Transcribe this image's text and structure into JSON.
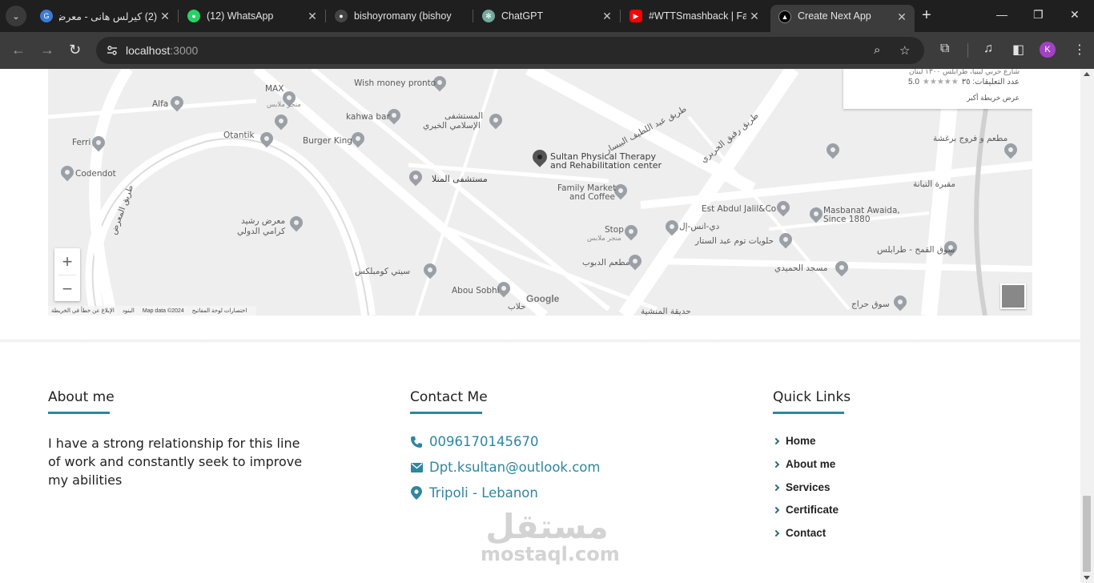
{
  "browser": {
    "tabs": [
      {
        "title": "(2) كيرلس هانى - معرض",
        "badge": "2",
        "favicon": "mostaql-icon",
        "color": "#3a7bd5"
      },
      {
        "title": "(12) WhatsApp",
        "badge": "12",
        "favicon": "whatsapp-icon",
        "color": "#25d366"
      },
      {
        "title": "bishoyromany (bishoy",
        "favicon": "github-icon",
        "color": "#444"
      },
      {
        "title": "ChatGPT",
        "favicon": "chatgpt-icon",
        "color": "#74aa9c"
      },
      {
        "title": "#WTTSmashback | Fa",
        "favicon": "youtube-icon",
        "color": "#ff0000"
      },
      {
        "title": "Create Next App",
        "favicon": "nextjs-icon",
        "color": "#000000"
      }
    ],
    "url_host": "localhost",
    "url_port": ":3000",
    "profile_initial": "K"
  },
  "map": {
    "place_name": "Sultan Physical Therapy and Rehabilitation center",
    "place_name_line1": "Sultan Physical Therapy",
    "place_name_line2": "and Rehabilitation center",
    "card": {
      "address": "شارع حربي ليبيا، طرابلس ١٣٠٠ لبنان",
      "rating": "5.0",
      "stars": "★★★★★",
      "reviews": "عدد التعليقات: ٣٥",
      "larger_map": "عرض خريطة أكبر"
    },
    "labels": [
      "Wish money pronto",
      "MAX",
      "منجر ملابس",
      "Alfa",
      "kahwa bar",
      "المستشفى",
      "الإسلامي الخيري",
      "Burger King",
      "Otantik",
      "Ferri",
      "Codendot",
      "مستشفى المنلا",
      "Family Market",
      "and Coffee",
      "معرض رشيد",
      "كرامي الدولي",
      "Stop",
      "منجر ملابس",
      "دي-انس-إل",
      "Est Abdul Jalil&Co",
      "Masbanat Awaida,",
      "Since 1880",
      "حلويات توم عبد الستار",
      "مطعم الدبوب",
      "مسجد الحميدي",
      "سيتي كومبلكس",
      "Abou Sobhi",
      "سوق القمح - طرابلس",
      "مطعم و فروج برغشة",
      "مقبرة التبانة",
      "سوق حراج",
      "حلاب",
      "حديقة المنشية",
      "طريق رفيق الحريري",
      "طريق عبد اللطيف البيسار",
      "طريق المعرض"
    ],
    "google": "Google",
    "attribution": [
      "اختصارات لوحة المفاتيح",
      "Map data ©2024",
      "البنود",
      "الإبلاغ عن خطأ في الخريطة"
    ],
    "zoom_in": "+",
    "zoom_out": "−"
  },
  "footer": {
    "about": {
      "heading": "About me",
      "text": "I have a strong relationship for this line of work and constantly seek to improve my abilities"
    },
    "contact": {
      "heading": "Contact Me",
      "phone": "0096170145670",
      "email": "Dpt.ksultan@outlook.com",
      "location": "Tripoli - Lebanon"
    },
    "quick_links": {
      "heading": "Quick Links",
      "items": [
        "Home",
        "About me",
        "Services",
        "Certificate",
        "Contact"
      ]
    }
  },
  "watermark": {
    "arabic": "مستقل",
    "latin": "mostaql.com"
  },
  "colors": {
    "accent": "#2e86a0",
    "chrome_dark": "#1f1f1f",
    "chrome_toolbar": "#3c3c3c"
  }
}
